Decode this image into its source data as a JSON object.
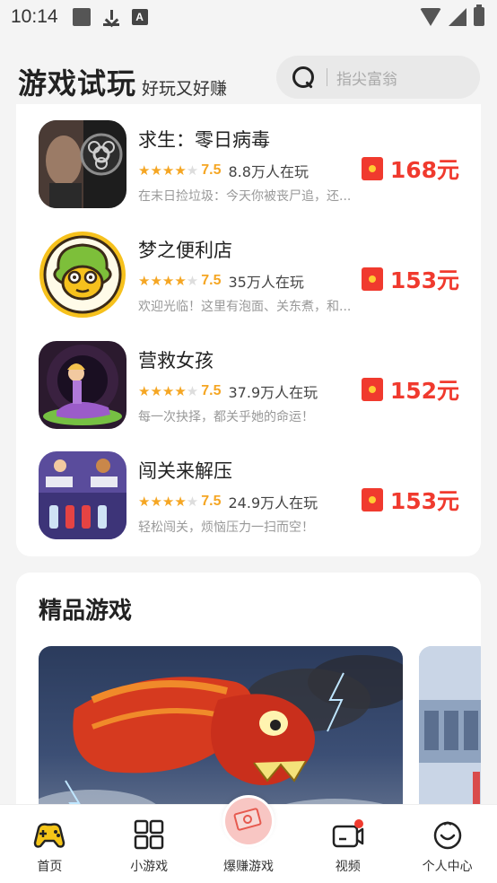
{
  "status": {
    "time": "10:14"
  },
  "header": {
    "title": "游戏试玩",
    "subtitle": "好玩又好赚",
    "search_placeholder": "指尖富翁"
  },
  "games": [
    {
      "name": "求生：零日病毒",
      "score": "7.5",
      "players": "8.8万人在玩",
      "desc": "在末日捡垃圾：今天你被丧尸追，还...",
      "reward": "168元"
    },
    {
      "name": "梦之便利店",
      "score": "7.5",
      "players": "35万人在玩",
      "desc": "欢迎光临！这里有泡面、关东煮，和...",
      "reward": "153元"
    },
    {
      "name": "营救女孩",
      "score": "7.5",
      "players": "37.9万人在玩",
      "desc": "每一次抉择，都关乎她的命运！",
      "reward": "152元"
    },
    {
      "name": "闯关来解压",
      "score": "7.5",
      "players": "24.9万人在玩",
      "desc": "轻松闯关，烦恼压力一扫而空！",
      "reward": "153元"
    }
  ],
  "featured": {
    "title": "精品游戏"
  },
  "nav": {
    "items": [
      {
        "label": "首页"
      },
      {
        "label": "小游戏"
      },
      {
        "label": "爆赚游戏"
      },
      {
        "label": "视频"
      },
      {
        "label": "个人中心"
      }
    ]
  },
  "colors": {
    "accent": "#f03a2e",
    "star": "#f5a623",
    "nav_active": "#f5c518"
  }
}
